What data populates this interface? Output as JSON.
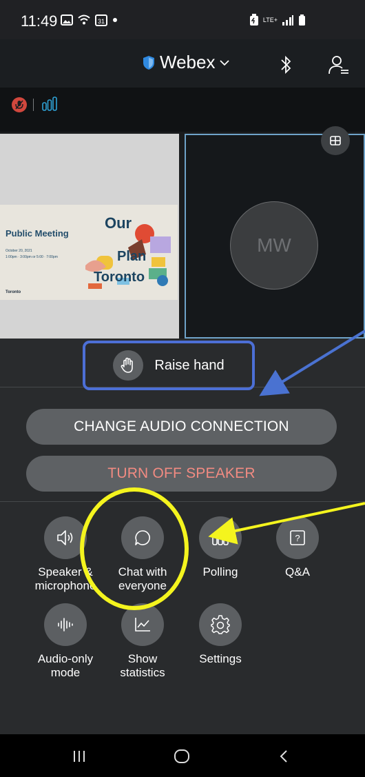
{
  "status_bar": {
    "time": "11:49",
    "net": "LTE+"
  },
  "header": {
    "app_title": "Webex"
  },
  "slide": {
    "title": "Public Meeting",
    "date": "October 20, 2021",
    "times": "1:00pm · 3:00pm or 5:00 · 7:00pm",
    "brand_line1": "Our",
    "brand_line2": "Plan",
    "brand_line3": "Toronto",
    "footer_logo": "Toronto"
  },
  "participant": {
    "initials": "MW"
  },
  "raise_hand": {
    "label": "Raise hand"
  },
  "audio": {
    "change_label": "CHANGE AUDIO CONNECTION",
    "speaker_off_label": "TURN OFF SPEAKER",
    "speaker_off_color": "#f28b82"
  },
  "actions": [
    {
      "label": "Speaker & microphone",
      "icon": "speaker-icon"
    },
    {
      "label": "Chat with everyone",
      "icon": "chat-icon"
    },
    {
      "label": "Polling",
      "icon": "polling-icon"
    },
    {
      "label": "Q&A",
      "icon": "qa-icon"
    },
    {
      "label": "Audio-only mode",
      "icon": "waveform-icon"
    },
    {
      "label": "Show statistics",
      "icon": "statistics-icon"
    },
    {
      "label": "Settings",
      "icon": "gear-icon"
    }
  ],
  "annotations": {
    "box_color": "#4c6fd6",
    "circle_color": "#f4f41e",
    "arrow_blue": "#4a72d1",
    "arrow_yellow": "#f4f41e"
  }
}
